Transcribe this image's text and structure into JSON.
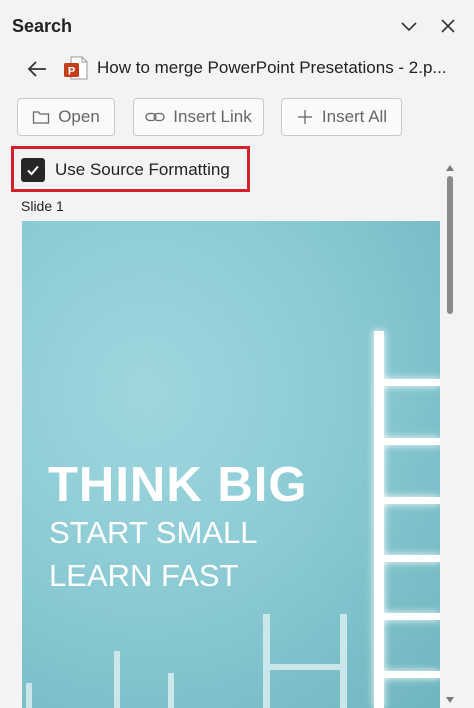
{
  "pane": {
    "title": "Search"
  },
  "file": {
    "name": "How to merge PowerPoint Presetations - 2.p..."
  },
  "toolbar": {
    "open_label": "Open",
    "insert_link_label": "Insert Link",
    "insert_all_label": "Insert All"
  },
  "options": {
    "use_source_formatting_label": "Use Source Formatting",
    "use_source_formatting_checked": true
  },
  "slides": [
    {
      "label": "Slide 1",
      "headline": "THINK BIG",
      "line2": "START SMALL",
      "line3": "LEARN FAST",
      "background_color": "#8ccbd4"
    }
  ],
  "colors": {
    "highlight": "#d4202a",
    "ppt_brand": "#c43e1c"
  }
}
